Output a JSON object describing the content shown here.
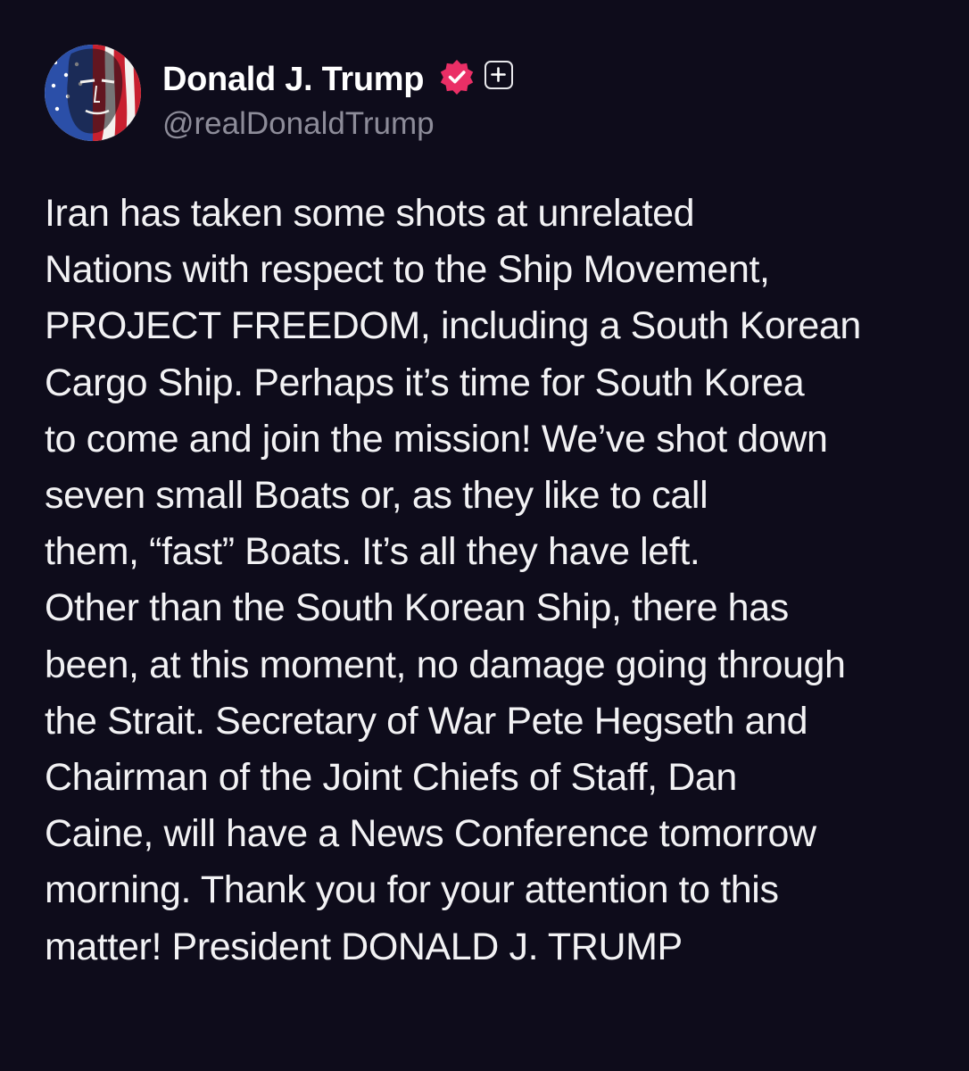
{
  "author": {
    "display_name": "Donald J. Trump",
    "handle": "@realDonaldTrump",
    "verified": true,
    "badge_color": "#ea2f66"
  },
  "post": {
    "lines": [
      "Iran has taken some shots at unrelated",
      "Nations with respect to the Ship Movement,",
      "PROJECT FREEDOM, including a South Korean",
      "Cargo Ship. Perhaps it’s time for South Korea",
      "to come and join the mission! We’ve shot down",
      "seven small Boats or, as they like to call",
      "them, “fast” Boats. It’s all they have left.",
      "Other than the South Korean Ship, there has",
      "been, at this moment, no damage going through",
      "the Strait. Secretary of War Pete Hegseth and",
      "Chairman of the Joint Chiefs of Staff, Dan",
      "Caine, will have a News Conference tomorrow",
      "morning. Thank you for your attention to this",
      "matter! President DONALD J. TRUMP"
    ]
  },
  "theme": {
    "background": "#0e0c1b",
    "text": "#f2f2f4",
    "muted": "#8d8c99"
  }
}
